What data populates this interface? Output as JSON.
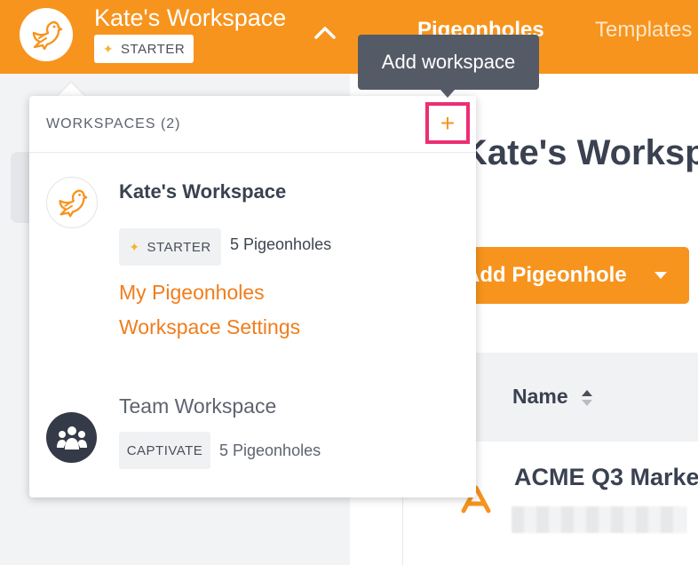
{
  "header": {
    "workspace_title": "Kate's Workspace",
    "plan_badge": "STARTER",
    "nav_tabs": [
      {
        "label": "Pigeonholes"
      },
      {
        "label": "Templates"
      }
    ]
  },
  "main": {
    "title": "Kate's Workspace",
    "add_button_label": "Add Pigeonhole",
    "table": {
      "column_name": "Name",
      "rows": [
        {
          "title": "ACME Q3 Marke"
        }
      ]
    }
  },
  "dropdown": {
    "header_label": "WORKSPACES (2)",
    "add_symbol": "+",
    "tooltip": "Add workspace",
    "workspaces": [
      {
        "name": "Kate's Workspace",
        "plan": "STARTER",
        "count": "5 Pigeonholes",
        "links": [
          "My Pigeonholes",
          "Workspace Settings"
        ]
      },
      {
        "name": "Team Workspace",
        "plan": "CAPTIVATE",
        "count": "5 Pigeonholes"
      }
    ]
  },
  "colors": {
    "brand_orange": "#f7941d",
    "highlight_pink": "#ec2e72",
    "tooltip_bg": "#555b66"
  }
}
